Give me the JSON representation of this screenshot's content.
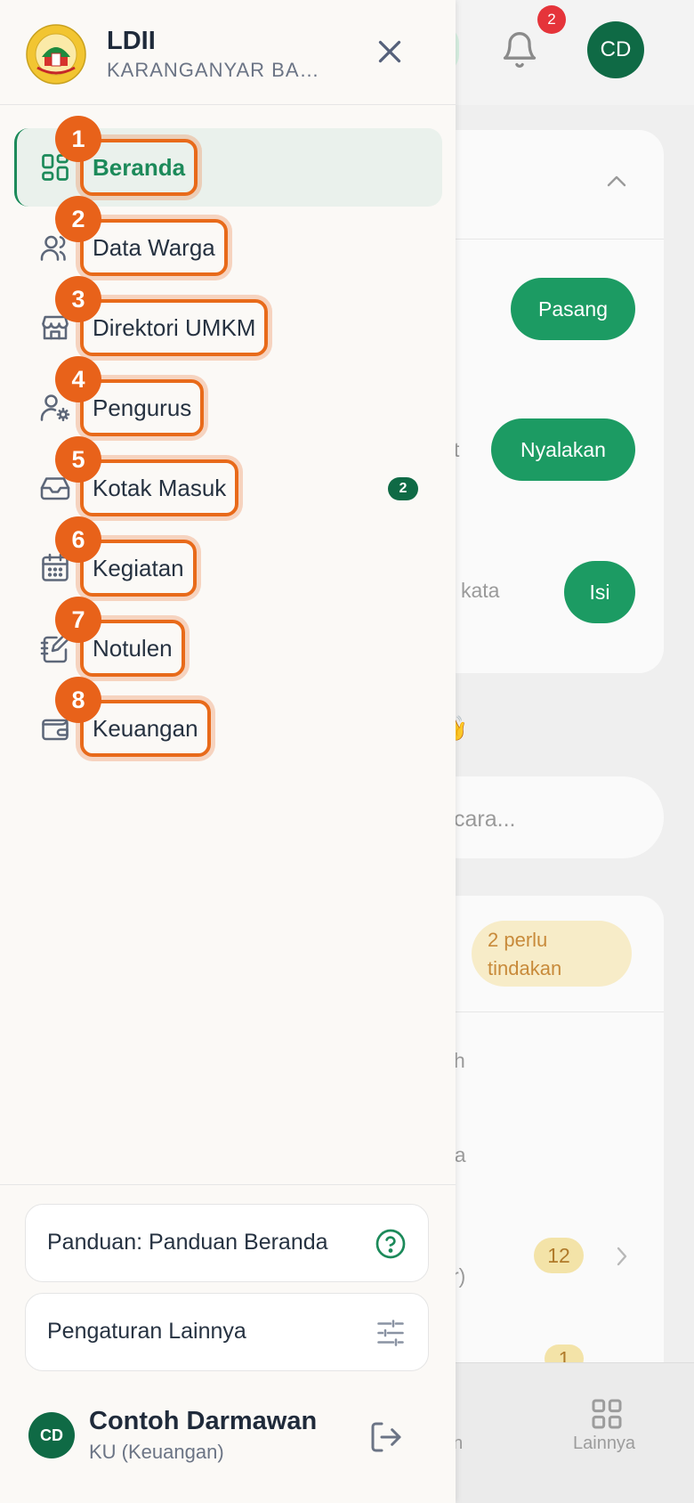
{
  "header": {
    "org_name": "LDII",
    "org_subtitle": "KARANGANYAR BARAT",
    "notification_count": "2",
    "avatar_initials": "CD"
  },
  "menu": {
    "items": [
      {
        "number": "1",
        "label": "Beranda",
        "icon": "dashboard-grid-icon",
        "active": true
      },
      {
        "number": "2",
        "label": "Data Warga",
        "icon": "users-icon"
      },
      {
        "number": "3",
        "label": "Direktori UMKM",
        "icon": "store-icon"
      },
      {
        "number": "4",
        "label": "Pengurus",
        "icon": "user-gear-icon"
      },
      {
        "number": "5",
        "label": "Kotak Masuk",
        "icon": "inbox-icon",
        "badge": "2"
      },
      {
        "number": "6",
        "label": "Kegiatan",
        "icon": "calendar-icon"
      },
      {
        "number": "7",
        "label": "Notulen",
        "icon": "notebook-pen-icon"
      },
      {
        "number": "8",
        "label": "Keuangan",
        "icon": "wallet-icon"
      }
    ]
  },
  "footer": {
    "guide_label": "Panduan: Panduan Beranda",
    "settings_label": "Pengaturan Lainnya",
    "user_initials": "CD",
    "user_name": "Contoh Darmawan",
    "user_role": "KU (Keuangan)"
  },
  "background": {
    "btn_pasang": "Pasang",
    "btn_nyalakan": "Nyalakan",
    "btn_isi": "Isi",
    "frag_n": "n",
    "frag_t": "t",
    "frag_kata": "kata",
    "frag_greeting": "n",
    "wave": "👋",
    "search_fragment": "cara...",
    "tag_text": "2 perlu tindakan",
    "frag_h": "h",
    "frag_da": "da",
    "frag_r": "r)",
    "count_12": "12",
    "count_1": "1",
    "nav_fragment": "an",
    "nav_lainnya": "Lainnya"
  },
  "colors": {
    "accent_green": "#1c8a5a",
    "highlight_orange": "#e8621a",
    "badge_red": "#e5343a"
  }
}
